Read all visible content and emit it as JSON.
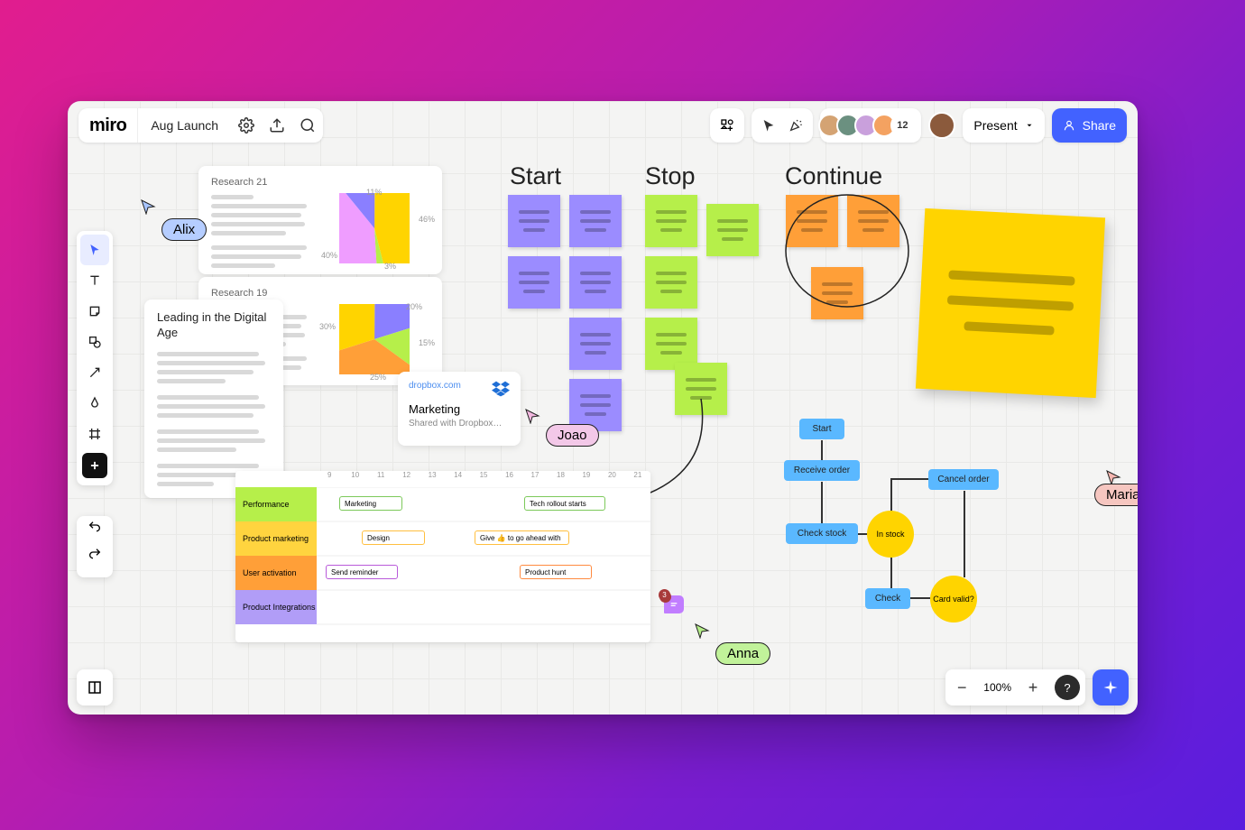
{
  "brand": "miro",
  "board_title": "Aug Launch",
  "present_label": "Present",
  "share_label": "Share",
  "avatar_overflow": "12",
  "zoom_level": "100%",
  "help_label": "?",
  "headings": {
    "start": "Start",
    "stop": "Stop",
    "continue": "Continue"
  },
  "cursors": {
    "alix": "Alix",
    "joao": "Joao",
    "anna": "Anna",
    "maria": "Maria"
  },
  "research_cards": [
    {
      "title": "Research 21",
      "labels": [
        "11%",
        "46%",
        "3%",
        "40%"
      ]
    },
    {
      "title": "Research 19",
      "labels": [
        "20%",
        "15%",
        "25%",
        "30%"
      ]
    }
  ],
  "doc_title": "Leading in the Digital Age",
  "dropbox": {
    "site": "dropbox.com",
    "title": "Marketing",
    "shared": "Shared with Dropbox…"
  },
  "timeline": {
    "hours": [
      "9",
      "10",
      "11",
      "12",
      "13",
      "14",
      "15",
      "16",
      "17",
      "18",
      "19",
      "20",
      "21"
    ],
    "rows": [
      {
        "label": "Performance",
        "color": "#b6ef4a"
      },
      {
        "label": "Product marketing",
        "color": "#ffd43f"
      },
      {
        "label": "User activation",
        "color": "#ff9f38"
      },
      {
        "label": "Product Integrations",
        "color": "#b19df7"
      }
    ],
    "bars": [
      {
        "label": "Marketing",
        "color": "#7cc95a"
      },
      {
        "label": "Tech rollout starts",
        "color": "#7cc95a"
      },
      {
        "label": "Design",
        "color": "#ffbf3f"
      },
      {
        "label": "Give 👍 to go ahead with",
        "color": "#ffbf3f"
      },
      {
        "label": "Send reminder",
        "color": "#b95ada"
      },
      {
        "label": "Product hunt",
        "color": "#ff8a3f"
      }
    ]
  },
  "flow": {
    "nodes": [
      "Start",
      "Receive order",
      "Check stock",
      "Cancel order",
      "Check"
    ],
    "diamonds": [
      "In stock",
      "Card valid?"
    ]
  },
  "comment_count": "3",
  "avatar_colors": [
    "#d4a373",
    "#6b9080",
    "#c9a0dc",
    "#f4a261"
  ],
  "main_avatar": "#8b5a3c"
}
